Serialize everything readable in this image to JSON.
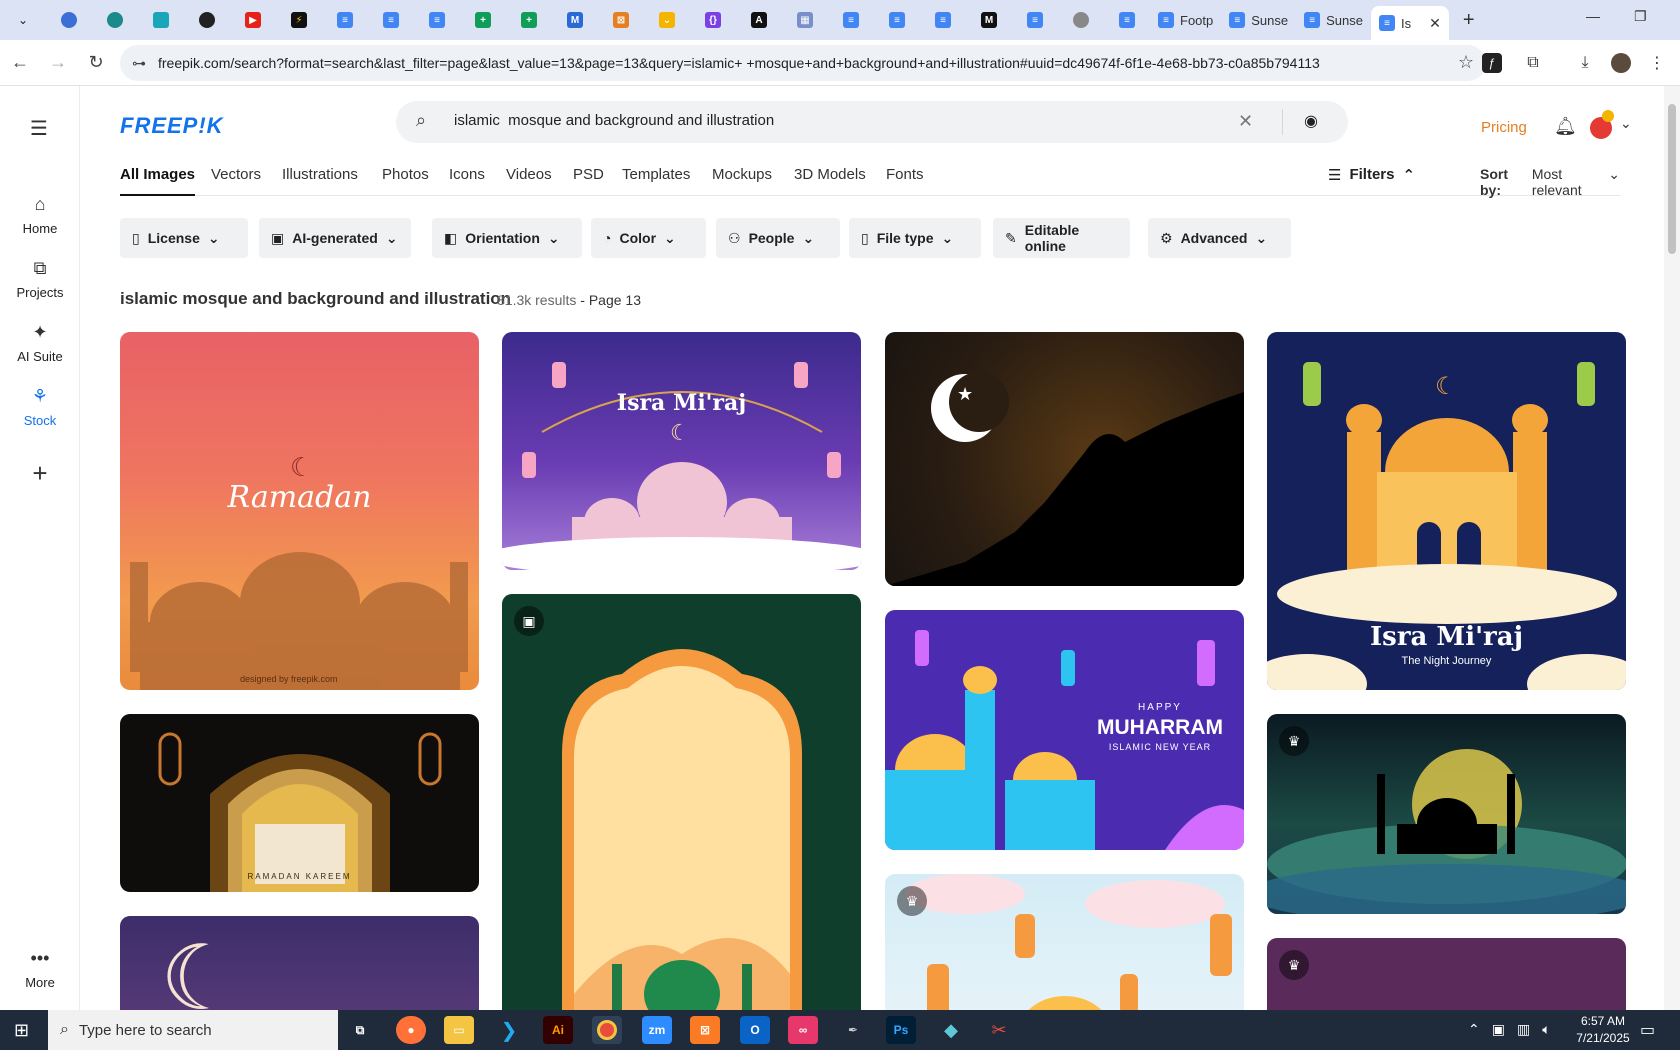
{
  "browser": {
    "tabs": [
      {
        "label": "Footp",
        "icon": "docs-icon"
      },
      {
        "label": "Sunse",
        "icon": "docs-icon"
      },
      {
        "label": "Sunse",
        "icon": "docs-icon"
      },
      {
        "label": "Is",
        "icon": "docs-icon",
        "active": true
      }
    ],
    "url": "freepik.com/search?format=search&last_filter=page&last_value=13&page=13&query=islamic+ +mosque+and+background+and+illustration#uuid=dc49674f-6f1e-4e68-bb73-c0a85b794113"
  },
  "rail": {
    "items": [
      {
        "label": "Home",
        "icon": "home-icon"
      },
      {
        "label": "Projects",
        "icon": "projects-icon"
      },
      {
        "label": "AI Suite",
        "icon": "sparkle-icon"
      },
      {
        "label": "Stock",
        "icon": "stock-icon"
      },
      {
        "label": "More",
        "icon": "more-icon"
      }
    ]
  },
  "header": {
    "logo": "FREEP!K",
    "search_value": "islamic  mosque and background and illustration",
    "pricing": "Pricing"
  },
  "filter_tabs": [
    "All Images",
    "Vectors",
    "Illustrations",
    "Photos",
    "Icons",
    "Videos",
    "PSD",
    "Templates",
    "Mockups",
    "3D Models",
    "Fonts"
  ],
  "filters_label": "Filters",
  "sort": {
    "label": "Sort by:",
    "value": "Most relevant"
  },
  "pills": [
    "License",
    "AI-generated",
    "Orientation",
    "Color",
    "People",
    "File type",
    "Editable online",
    "Advanced"
  ],
  "results": {
    "query": "islamic mosque and background and illustration",
    "count": "81.3k results",
    "page": "- Page 13"
  },
  "cards": {
    "ramadan": {
      "title": "Ramadan",
      "credit": "designed by freepik.com"
    },
    "isra_top": {
      "title": "Isra Mi'raj"
    },
    "ramadan_kareem": {
      "caption": "RAMADAN KAREEM"
    },
    "muharram": {
      "happy": "HAPPY",
      "title": "MUHARRAM",
      "subtitle": "ISLAMIC NEW YEAR"
    },
    "isra_right": {
      "title": "Isra Mi'raj",
      "subtitle": "The Night Journey"
    }
  },
  "taskbar": {
    "search_placeholder": "Type here to search",
    "time": "6:57 AM",
    "date": "7/21/2025"
  },
  "colors": {
    "brand": "#1273eb",
    "pricing": "#e67e22"
  }
}
